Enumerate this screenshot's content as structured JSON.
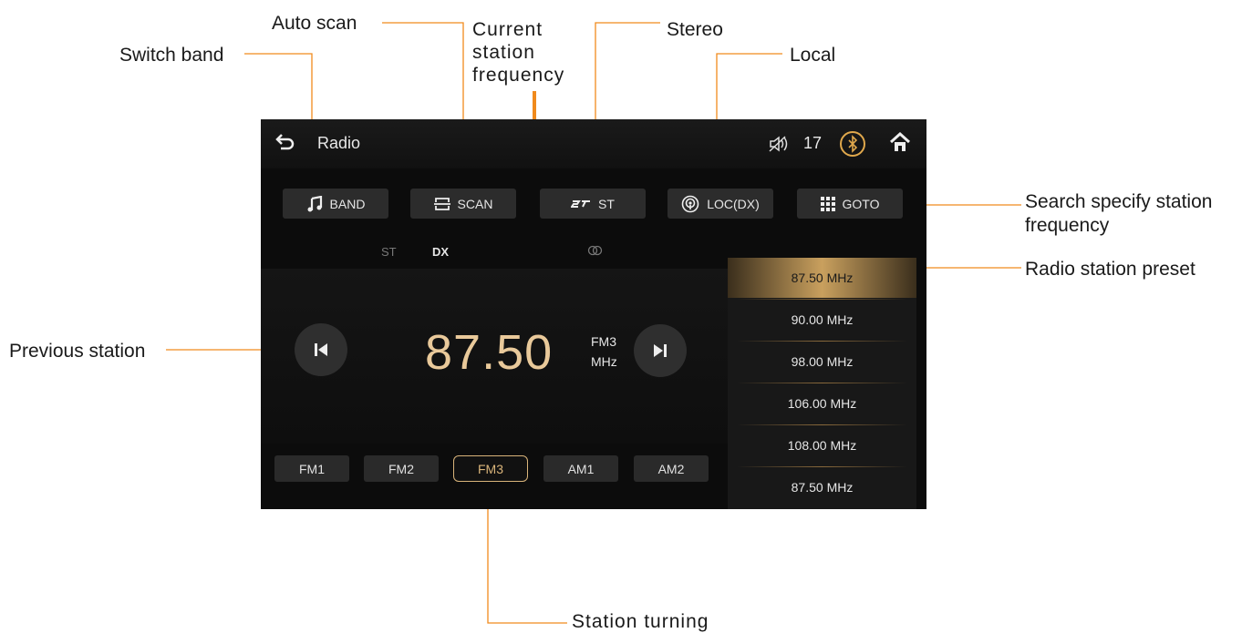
{
  "callouts": {
    "switch_band": "Switch band",
    "auto_scan": "Auto scan",
    "current_freq": "Current\nstation\nfrequency",
    "stereo": "Stereo",
    "local": "Local",
    "search_freq": "Search specify station\nfrequency",
    "preset": "Radio station preset",
    "previous": "Previous station",
    "tuning": "Station turning"
  },
  "topbar": {
    "title": "Radio",
    "volume": "17"
  },
  "toolbar": {
    "band": "BAND",
    "scan": "SCAN",
    "st": "ST",
    "loc": "LOC(DX)",
    "goto": "GOTO"
  },
  "indicators": {
    "st": "ST",
    "dx": "DX"
  },
  "main": {
    "frequency": "87.50",
    "band": "FM3",
    "unit": "MHz"
  },
  "bands": [
    "FM1",
    "FM2",
    "FM3",
    "AM1",
    "AM2"
  ],
  "selected_band": "FM3",
  "presets": [
    "87.50 MHz",
    "90.00 MHz",
    "98.00 MHz",
    "106.00 MHz",
    "108.00 MHz",
    "87.50 MHz"
  ],
  "colors": {
    "accent": "#f08a1c",
    "frequency": "#e9c99a",
    "selected": "#d9b47a"
  }
}
